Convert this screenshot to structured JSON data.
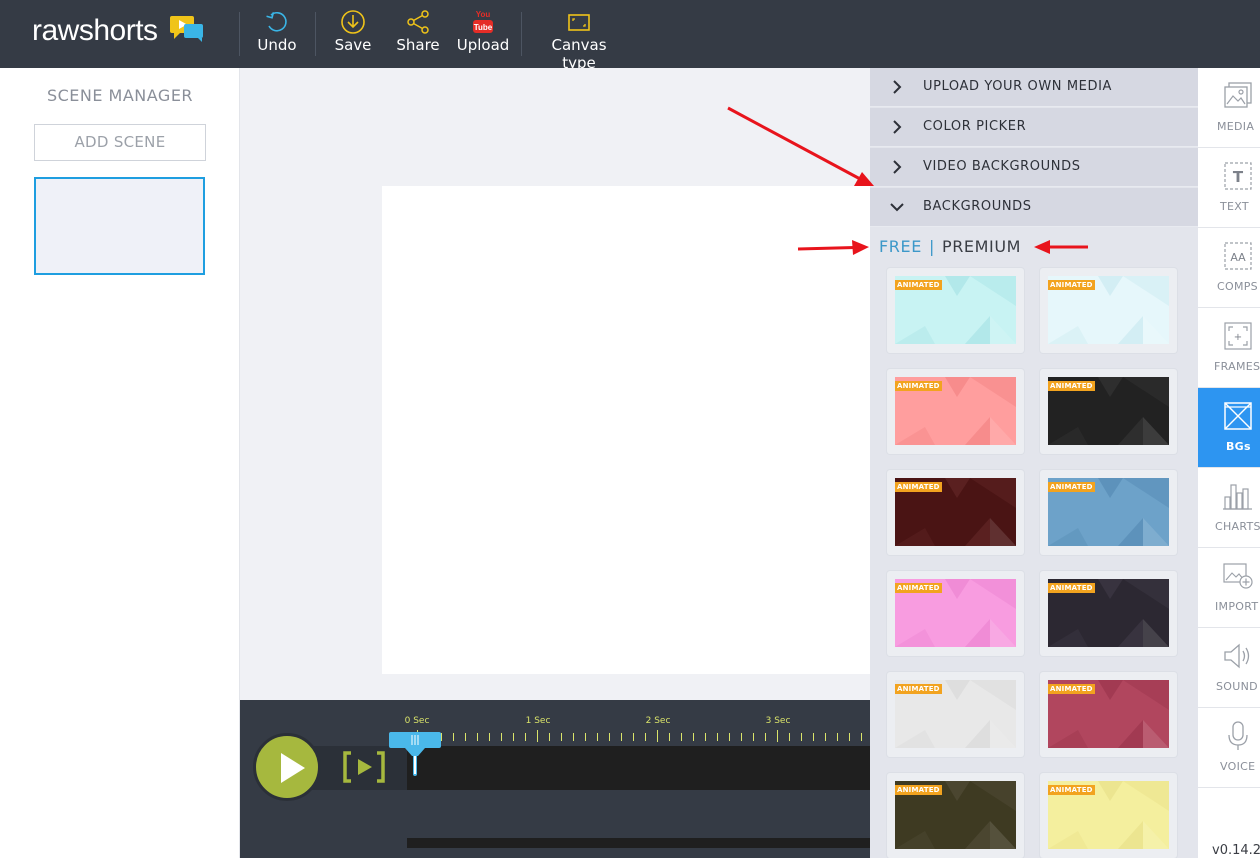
{
  "app": {
    "logo_text": "rawshorts",
    "version": "v0.14.2"
  },
  "toolbar": {
    "undo": "Undo",
    "save": "Save",
    "share": "Share",
    "upload": "Upload",
    "upload_badge": "You Tube",
    "canvas_type": "Canvas type"
  },
  "scene_manager": {
    "title": "SCENE MANAGER",
    "add_scene": "ADD SCENE"
  },
  "timeline": {
    "ticks": [
      "0 Sec",
      "1 Sec",
      "2 Sec",
      "3 Sec"
    ]
  },
  "panel": {
    "sections": [
      {
        "label": "UPLOAD YOUR OWN MEDIA",
        "expanded": false
      },
      {
        "label": "COLOR PICKER",
        "expanded": false
      },
      {
        "label": "VIDEO BACKGROUNDS",
        "expanded": false
      },
      {
        "label": "BACKGROUNDS",
        "expanded": true
      }
    ],
    "tabs": {
      "free": "FREE",
      "separator": "|",
      "premium": "PREMIUM",
      "active": "FREE"
    },
    "badge": "ANIMATED",
    "backgrounds": [
      {
        "color": "#c8f3f3",
        "accent": "#b2e8ea"
      },
      {
        "color": "#e6f7fb",
        "accent": "#d3eef4"
      },
      {
        "color": "#ff9e9e",
        "accent": "#f78c8c"
      },
      {
        "color": "#222222",
        "accent": "#2e2e2e"
      },
      {
        "color": "#4a1414",
        "accent": "#5a2020"
      },
      {
        "color": "#6da2c9",
        "accent": "#5d92bb"
      },
      {
        "color": "#f89ce0",
        "accent": "#f08cd6"
      },
      {
        "color": "#2c2832",
        "accent": "#38333f"
      },
      {
        "color": "#e8e8e8",
        "accent": "#dedede"
      },
      {
        "color": "#b1465e",
        "accent": "#a23a52"
      },
      {
        "color": "#3e3a22",
        "accent": "#4b4630"
      },
      {
        "color": "#f4ef9e",
        "accent": "#ece590"
      }
    ]
  },
  "rail": [
    {
      "label": "MEDIA",
      "icon": "media-icon",
      "active": false
    },
    {
      "label": "TEXT",
      "icon": "text-icon",
      "active": false
    },
    {
      "label": "COMPS",
      "icon": "comps-icon",
      "active": false
    },
    {
      "label": "FRAMES",
      "icon": "frames-icon",
      "active": false
    },
    {
      "label": "BGs",
      "icon": "backgrounds-icon",
      "active": true
    },
    {
      "label": "CHARTS",
      "icon": "charts-icon",
      "active": false
    },
    {
      "label": "IMPORT",
      "icon": "import-icon",
      "active": false
    },
    {
      "label": "SOUND",
      "icon": "sound-icon",
      "active": false
    },
    {
      "label": "VOICE",
      "icon": "voice-icon",
      "active": false
    }
  ],
  "colors": {
    "topbar": "#353b45",
    "accent_yellow": "#f0c419",
    "selection_blue": "#1e9ee0",
    "rail_active": "#2d95f1",
    "play_green": "#a6b83e",
    "annotation_red": "#e8141c"
  }
}
